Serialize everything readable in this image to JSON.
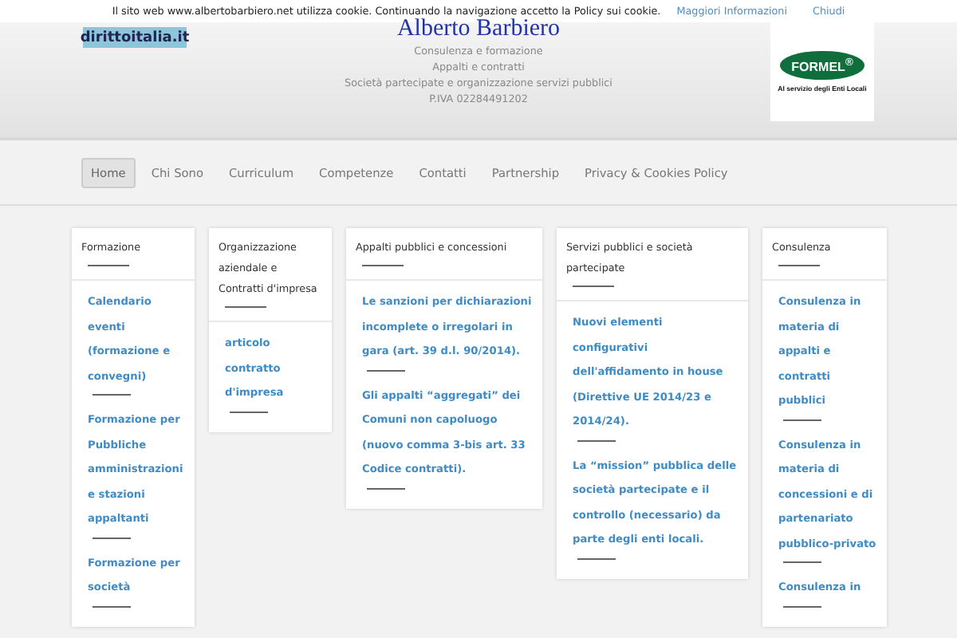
{
  "cookie_bar": {
    "message": "Il sito web www.albertobarbiero.net utilizza cookie. Continuando la navigazione accetto la Policy sui cookie.",
    "more_link": "Maggiori Informazioni",
    "close_link": "Chiudi"
  },
  "header": {
    "left_logo": {
      "text": "dirittoitalia.it"
    },
    "title": "Alberto Barbiero",
    "taglines": [
      "Consulenza e formazione",
      "Appalti e contratti",
      "Società partecipate e organizzazione servizi pubblici",
      "P.IVA 02284491202"
    ],
    "right_logo": {
      "text": "FORMEL",
      "mark": "®",
      "caption": "Al servizio degli Enti Locali"
    }
  },
  "nav": [
    {
      "label": "Home",
      "selected": true
    },
    {
      "label": "Chi Sono",
      "selected": false
    },
    {
      "label": "Curriculum",
      "selected": false
    },
    {
      "label": "Competenze",
      "selected": false
    },
    {
      "label": "Contatti",
      "selected": false
    },
    {
      "label": "Partnership",
      "selected": false
    },
    {
      "label": "Privacy & Cookies Policy",
      "selected": false
    }
  ],
  "widgets": [
    {
      "title": "Formazione",
      "links": [
        "Calendario eventi (formazione e convegni)",
        "Formazione per Pubbliche amministrazioni e stazioni appaltanti",
        "Formazione per società"
      ]
    },
    {
      "title": "Organizzazione aziendale e Contratti d'impresa",
      "links": [
        "articolo contratto d'impresa"
      ]
    },
    {
      "title": "Appalti pubblici e concessioni",
      "links": [
        "Le sanzioni per dichiarazioni incomplete o irregolari in gara (art. 39 d.l. 90/2014).",
        "Gli appalti “aggregati” dei Comuni non capoluogo (nuovo comma 3-bis art. 33 Codice contratti)."
      ]
    },
    {
      "title": "Servizi pubblici e società partecipate",
      "links": [
        "Nuovi elementi configurativi dell'affidamento in house (Direttive UE 2014/23 e 2014/24).",
        "La “mission” pubblica delle società partecipate e il controllo (necessario) da parte degli enti locali."
      ]
    },
    {
      "title": "Consulenza",
      "links": [
        "Consulenza in materia di appalti e contratti pubblici",
        "Consulenza in materia di concessioni e di partenariato pubblico-privato",
        "Consulenza in"
      ]
    }
  ]
}
